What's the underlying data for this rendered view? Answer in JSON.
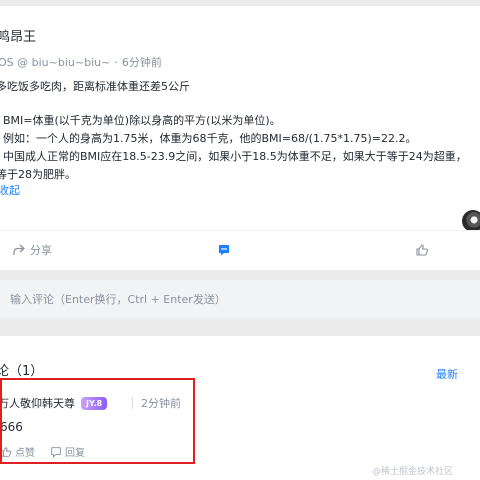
{
  "post": {
    "author": "鸣昂王",
    "meta": {
      "position": "OS @ biu~biu~biu~",
      "separator": "·",
      "time": "6分钟前"
    },
    "content": [
      "多吃饭多吃肉，距离标准体重还差5公斤",
      "",
      "· BMI=体重(以千克为单位)除以身高的平方(以米为单位)。",
      "· 例如：一个人的身高为1.75米，体重为68千克，他的BMI=68/(1.75*1.75)=22.2。",
      "· 中国成人正常的BMI应在18.5-23.9之间，如果小于18.5为体重不足，如果大于等于24为超重，",
      "等于28为肥胖。"
    ],
    "collapse_label": "收起"
  },
  "actions": {
    "share_label": "分享",
    "comment_icon": "comment-icon",
    "like_icon": "thumbs-up-icon",
    "share_icon": "share-icon"
  },
  "comment_input": {
    "placeholder": "输入评论（Enter换行，Ctrl + Enter发送）",
    "value": ""
  },
  "comments": {
    "title": "论（1）",
    "sort_label": "最新",
    "items": [
      {
        "user": "万人敬仰韩天尊",
        "badge": "JY.8",
        "time": "2分钟前",
        "text": "666",
        "like_label": "点赞",
        "reply_label": "回复"
      }
    ]
  },
  "highlight_color": "#e02020",
  "accent_color": "#1e80ff",
  "watermark": "@稀土掘金技术社区"
}
